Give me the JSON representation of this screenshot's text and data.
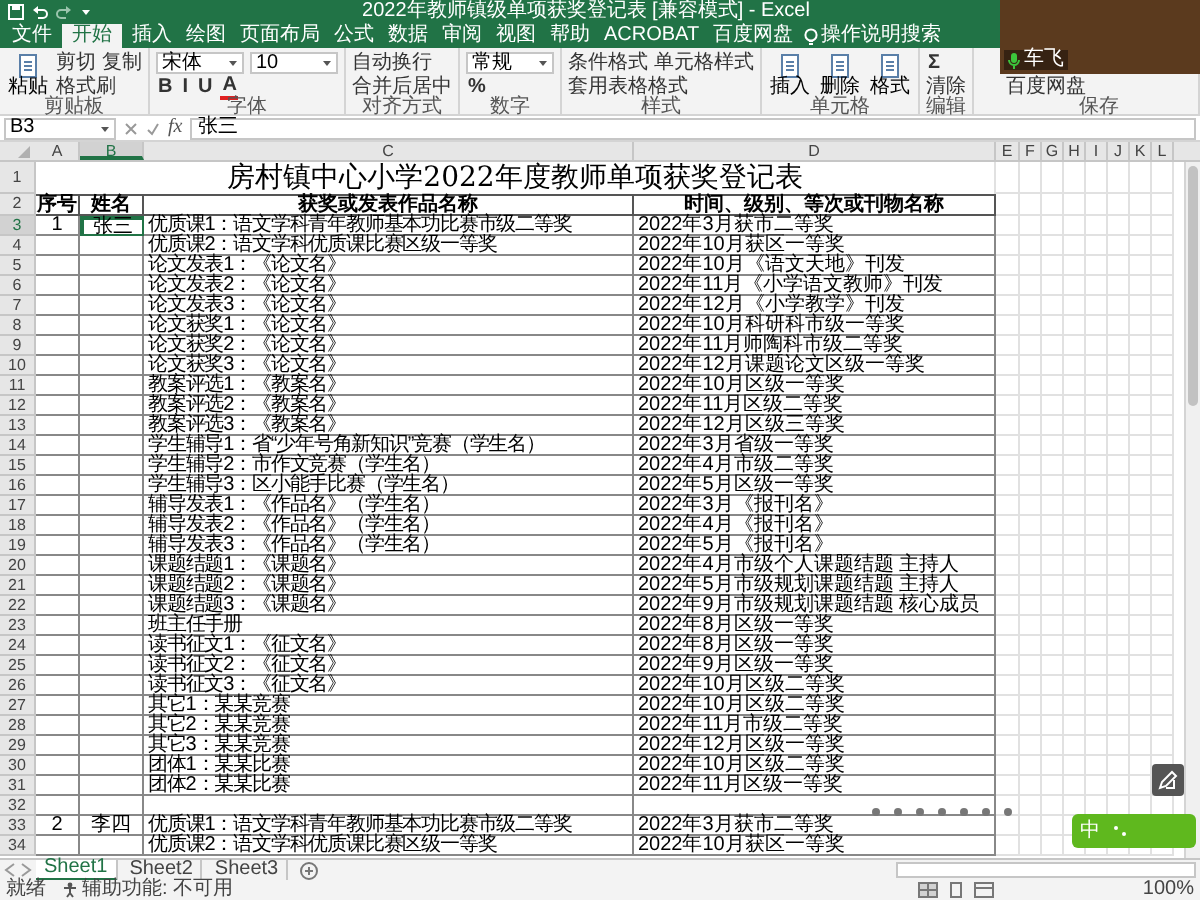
{
  "title_bar": {
    "title": "2022年教师镇级单项获奖登记表 [兼容模式] - Excel"
  },
  "ribbon_tabs": [
    {
      "label": "文件",
      "selected": false
    },
    {
      "label": "开始",
      "selected": true
    },
    {
      "label": "插入",
      "selected": false
    },
    {
      "label": "绘图",
      "selected": false
    },
    {
      "label": "页面布局",
      "selected": false
    },
    {
      "label": "公式",
      "selected": false
    },
    {
      "label": "数据",
      "selected": false
    },
    {
      "label": "审阅",
      "selected": false
    },
    {
      "label": "视图",
      "selected": false
    },
    {
      "label": "帮助",
      "selected": false
    },
    {
      "label": "ACROBAT",
      "selected": false
    },
    {
      "label": "百度网盘",
      "selected": false
    }
  ],
  "tell_me": "操作说明搜索",
  "ribbon_groups": [
    {
      "label": "剪贴板",
      "large": [
        "粘贴"
      ],
      "top": [
        {
          "kind": "button",
          "label": "剪切"
        },
        {
          "kind": "button",
          "label": "复制"
        }
      ],
      "bottom": [
        {
          "kind": "button",
          "label": "格式刷"
        }
      ]
    },
    {
      "label": "字体",
      "top": [
        {
          "kind": "field",
          "value": "宋体"
        },
        {
          "kind": "field",
          "value": "10"
        }
      ],
      "bottom": [
        {
          "kind": "glyph",
          "label": "B"
        },
        {
          "kind": "glyph",
          "label": "I"
        },
        {
          "kind": "glyph",
          "label": "U"
        },
        {
          "kind": "color_glyph",
          "label": "A"
        }
      ]
    },
    {
      "label": "对齐方式",
      "top": [
        {
          "kind": "button",
          "label": "自动换行"
        }
      ],
      "bottom": [
        {
          "kind": "button",
          "label": "合并后居中"
        }
      ]
    },
    {
      "label": "数字",
      "top": [
        {
          "kind": "field",
          "value": "常规"
        }
      ],
      "bottom": [
        {
          "kind": "glyph",
          "label": "%"
        }
      ]
    },
    {
      "label": "样式",
      "top": [
        {
          "kind": "button",
          "label": "条件格式"
        },
        {
          "kind": "button",
          "label": "单元格样式"
        }
      ],
      "bottom": [
        {
          "kind": "button",
          "label": "套用表格格式"
        }
      ]
    },
    {
      "label": "单元格",
      "large": [
        "插入",
        "删除",
        "格式"
      ]
    },
    {
      "label": "编辑",
      "top": [
        {
          "kind": "glyph",
          "label": "Σ"
        }
      ],
      "bottom": [
        {
          "kind": "button",
          "label": "清除"
        }
      ]
    },
    {
      "label": "保存",
      "bottom": [
        {
          "kind": "button",
          "label": "百度网盘"
        }
      ]
    }
  ],
  "formula_bar": {
    "name_box": "B3",
    "function_label": "fx",
    "value": "张三"
  },
  "columns": [
    {
      "label": "A",
      "selected": false
    },
    {
      "label": "B",
      "selected": true
    },
    {
      "label": "C",
      "selected": false
    },
    {
      "label": "D",
      "selected": false
    },
    {
      "label": "E",
      "selected": false
    },
    {
      "label": "F",
      "selected": false
    },
    {
      "label": "G",
      "selected": false
    },
    {
      "label": "H",
      "selected": false
    },
    {
      "label": "I",
      "selected": false
    },
    {
      "label": "J",
      "selected": false
    },
    {
      "label": "K",
      "selected": false
    },
    {
      "label": "L",
      "selected": false
    }
  ],
  "sheet_title": {
    "row": "1",
    "text": "房村镇中心小学2022年度教师单项获奖登记表"
  },
  "header_row": {
    "row": "2",
    "cells": [
      "序号",
      "姓名",
      "获奖或发表作品名称",
      "时间、级别、等次或刊物名称"
    ]
  },
  "rows": [
    {
      "row": "3",
      "selected": true,
      "no": "1",
      "name": "张三",
      "item": "优质课1：语文学科青年教师基本功比赛市级二等奖",
      "detail": "2022年3月获市二等奖"
    },
    {
      "row": "4",
      "selected": false,
      "item": "优质课2：语文学科优质课比赛区级一等奖",
      "detail": "2022年10月获区一等奖"
    },
    {
      "row": "5",
      "selected": false,
      "item": "论文发表1：《论文名》",
      "detail": "2022年10月《语文天地》刊发"
    },
    {
      "row": "6",
      "selected": false,
      "item": "论文发表2：《论文名》",
      "detail": "2022年11月《小学语文教师》刊发"
    },
    {
      "row": "7",
      "selected": false,
      "item": "论文发表3：《论文名》",
      "detail": "2022年12月《小学教学》刊发"
    },
    {
      "row": "8",
      "selected": false,
      "item": "论文获奖1：《论文名》",
      "detail": "2022年10月科研科市级一等奖"
    },
    {
      "row": "9",
      "selected": false,
      "item": "论文获奖2：《论文名》",
      "detail": "2022年11月师陶科市级二等奖"
    },
    {
      "row": "10",
      "selected": false,
      "item": "论文获奖3：《论文名》",
      "detail": "2022年12月课题论文区级一等奖"
    },
    {
      "row": "11",
      "selected": false,
      "item": "教案评选1：《教案名》",
      "detail": "2022年10月区级一等奖"
    },
    {
      "row": "12",
      "selected": false,
      "item": "教案评选2：《教案名》",
      "detail": "2022年11月区级二等奖"
    },
    {
      "row": "13",
      "selected": false,
      "item": "教案评选3：《教案名》",
      "detail": "2022年12月区级三等奖"
    },
    {
      "row": "14",
      "selected": false,
      "item": "学生辅导1：省“少年号角新知识”竞赛（学生名）",
      "detail": "2022年3月省级一等奖"
    },
    {
      "row": "15",
      "selected": false,
      "item": "学生辅导2：市作文竞赛（学生名）",
      "detail": "2022年4月市级二等奖"
    },
    {
      "row": "16",
      "selected": false,
      "item": "学生辅导3：区小能手比赛（学生名）",
      "detail": "2022年5月区级一等奖"
    },
    {
      "row": "17",
      "selected": false,
      "item": "辅导发表1：《作品名》（学生名）",
      "detail": "2022年3月《报刊名》"
    },
    {
      "row": "18",
      "selected": false,
      "item": "辅导发表2：《作品名》（学生名）",
      "detail": "2022年4月《报刊名》"
    },
    {
      "row": "19",
      "selected": false,
      "item": "辅导发表3：《作品名》（学生名）",
      "detail": "2022年5月《报刊名》"
    },
    {
      "row": "20",
      "selected": false,
      "item": "课题结题1：《课题名》",
      "detail": "2022年4月市级个人课题结题 主持人"
    },
    {
      "row": "21",
      "selected": false,
      "item": "课题结题2：《课题名》",
      "detail": "2022年5月市级规划课题结题 主持人"
    },
    {
      "row": "22",
      "selected": false,
      "item": "课题结题3：《课题名》",
      "detail": "2022年9月市级规划课题结题 核心成员"
    },
    {
      "row": "23",
      "selected": false,
      "item": "班主任手册",
      "detail": "2022年8月区级一等奖"
    },
    {
      "row": "24",
      "selected": false,
      "item": "读书征文1：《征文名》",
      "detail": "2022年8月区级一等奖"
    },
    {
      "row": "25",
      "selected": false,
      "item": "读书征文2：《征文名》",
      "detail": "2022年9月区级一等奖"
    },
    {
      "row": "26",
      "selected": false,
      "item": "读书征文3：《征文名》",
      "detail": "2022年10月区级二等奖"
    },
    {
      "row": "27",
      "selected": false,
      "item": "其它1：某某竞赛",
      "detail": "2022年10月区级二等奖"
    },
    {
      "row": "28",
      "selected": false,
      "item": "其它2：某某竞赛",
      "detail": "2022年11月市级二等奖"
    },
    {
      "row": "29",
      "selected": false,
      "item": "其它3：某某竞赛",
      "detail": "2022年12月区级一等奖"
    },
    {
      "row": "30",
      "selected": false,
      "item": "团体1：某某比赛",
      "detail": "2022年10月区级二等奖"
    },
    {
      "row": "31",
      "selected": false,
      "item": "团体2：某某比赛",
      "detail": "2022年11月区级一等奖"
    },
    {
      "row": "32",
      "selected": false
    },
    {
      "row": "33",
      "selected": false,
      "no": "2",
      "name": "李四",
      "item": "优质课1：语文学科青年教师基本功比赛市级二等奖",
      "detail": "2022年3月获市二等奖"
    },
    {
      "row": "34",
      "selected": false,
      "item": "优质课2：语文学科优质课比赛区级一等奖",
      "detail": "2022年10月获区一等奖"
    }
  ],
  "sheet_tabs": [
    {
      "label": "Sheet1",
      "selected": true
    },
    {
      "label": "Sheet2",
      "selected": false
    },
    {
      "label": "Sheet3",
      "selected": false
    }
  ],
  "status_bar": {
    "ready": "就绪",
    "accessibility": "辅助功能: 不可用",
    "zoom": "100%"
  },
  "video_call": {
    "participant": "车飞"
  },
  "ime_widget": {
    "label": "中"
  }
}
